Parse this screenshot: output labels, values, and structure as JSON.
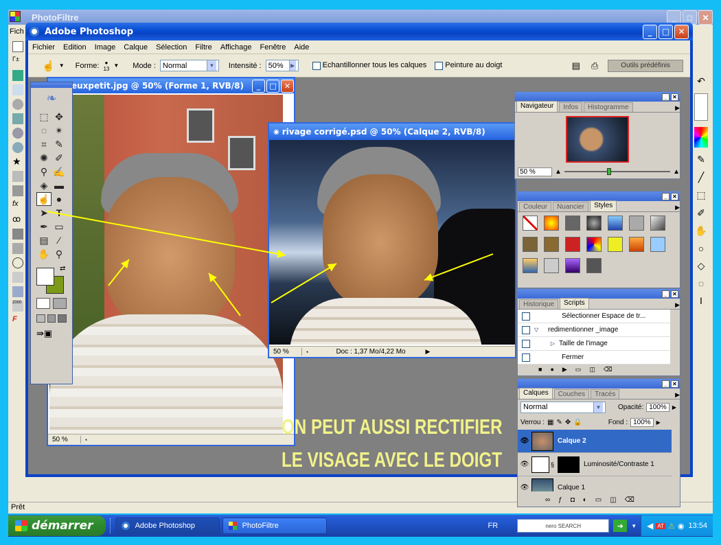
{
  "photofiltre": {
    "title": "PhotoFiltre",
    "menu_first": "Fich",
    "status": "Prêt"
  },
  "photoshop": {
    "title": "Adobe Photoshop",
    "menus": [
      "Fichier",
      "Edition",
      "Image",
      "Calque",
      "Sélection",
      "Filtre",
      "Affichage",
      "Fenêtre",
      "Aide"
    ],
    "options": {
      "forme_label": "Forme:",
      "brush_size": "13",
      "mode_label": "Mode :",
      "mode_value": "Normal",
      "intensite_label": "Intensité :",
      "intensite_value": "50%",
      "sample_all": "Echantillonner tous les calques",
      "finger": "Peinture au doigt",
      "presets": "Outils prédéfinis"
    }
  },
  "doc1": {
    "title": "euxpetit.jpg @ 50% (Forme 1, RVB/8)",
    "zoom": "50 %"
  },
  "doc2": {
    "title": "rivage corrigé.psd @ 50% (Calque 2, RVB/8)",
    "zoom": "50 %",
    "doc_info": "Doc : 1,37 Mo/4,22 Mo"
  },
  "navigator": {
    "tabs": [
      "Navigateur",
      "Infos",
      "Histogramme"
    ],
    "zoom": "50 %"
  },
  "styles_panel": {
    "tabs": [
      "Couleur",
      "Nuancier",
      "Styles"
    ]
  },
  "history_panel": {
    "tabs": [
      "Historique",
      "Scripts"
    ],
    "rows": [
      "Sélectionner Espace de tr...",
      "redimentionner _image",
      "Taille de l'image",
      "Fermer"
    ]
  },
  "layers_panel": {
    "tabs": [
      "Calques",
      "Couches",
      "Tracés"
    ],
    "blend_mode": "Normal",
    "opacity_label": "Opacité:",
    "opacity": "100%",
    "lock_label": "Verrou :",
    "fill_label": "Fond :",
    "fill": "100%",
    "layers": [
      "Calque 2",
      "Luminosité/Contraste 1",
      "Calque 1"
    ]
  },
  "caption": {
    "line1": "ON PEUT AUSSI RECTIFIER",
    "line2": "LE VISAGE AVEC LE DOIGT"
  },
  "taskbar": {
    "start": "démarrer",
    "tasks": [
      "Adobe Photoshop",
      "PhotoFiltre"
    ],
    "lang": "FR",
    "search": "nero SEARCH",
    "clock": "13:54"
  }
}
